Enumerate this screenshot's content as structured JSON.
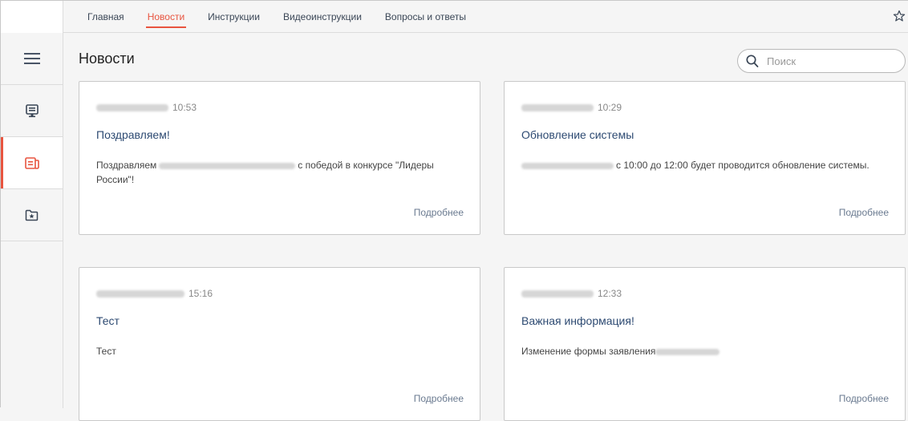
{
  "nav": {
    "tabs": [
      {
        "label": "Главная"
      },
      {
        "label": "Новости"
      },
      {
        "label": "Инструкции"
      },
      {
        "label": "Видеоинструкции"
      },
      {
        "label": "Вопросы и ответы"
      }
    ],
    "active_tab": "Новости"
  },
  "sidebar": {
    "items": [
      {
        "icon": "hamburger-menu-icon"
      },
      {
        "icon": "monitor-icon"
      },
      {
        "icon": "news-icon"
      },
      {
        "icon": "star-folder-icon"
      }
    ]
  },
  "page": {
    "title": "Новости"
  },
  "search": {
    "placeholder": "Поиск"
  },
  "cards": [
    {
      "time": "10:53",
      "title": "Поздравляем!",
      "body_pre": "Поздравляем",
      "body_post": "с победой в конкурсе \"Лидеры России\"!",
      "more": "Подробнее"
    },
    {
      "time": "10:29",
      "title": "Обновление системы",
      "body_pre": "",
      "body_post": "с 10:00 до 12:00 будет проводится обновление системы.",
      "more": "Подробнее"
    },
    {
      "time": "15:16",
      "title": "Тест",
      "body_pre": "Тест",
      "body_post": "",
      "more": "Подробнее"
    },
    {
      "time": "12:33",
      "title": "Важная информация!",
      "body_pre": "Изменение формы заявления",
      "body_post": "",
      "more": "Подробнее"
    }
  ],
  "colors": {
    "accent": "#e8543f",
    "title_link": "#2d4a72"
  }
}
